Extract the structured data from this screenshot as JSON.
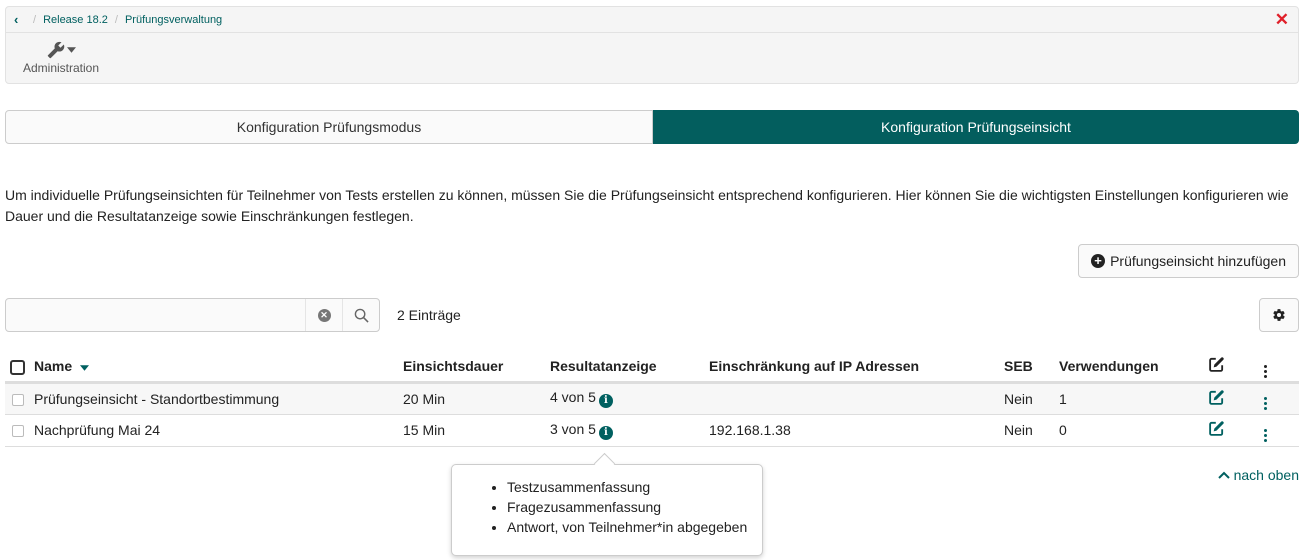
{
  "toolbar": {
    "breadcrumbs": [
      "Release 18.2",
      "Prüfungsverwaltung"
    ],
    "admin_label": "Administration"
  },
  "tabs": [
    {
      "label": "Konfiguration Prüfungsmodus",
      "active": false
    },
    {
      "label": "Konfiguration Prüfungseinsicht",
      "active": true
    }
  ],
  "description": "Um individuelle Prüfungseinsichten für Teilnehmer von Tests erstellen zu können, müssen Sie die Prüfungseinsicht entsprechend konfigurieren. Hier können Sie die wichtigsten Einstellungen konfigurieren wie Dauer und die Resultatanzeige sowie Einschränkungen festlegen.",
  "add_button": "Prüfungseinsicht hinzufügen",
  "search": {
    "value": "",
    "placeholder": ""
  },
  "entry_count": "2 Einträge",
  "table": {
    "headers": {
      "name": "Name",
      "duration": "Einsichtsdauer",
      "results": "Resultatanzeige",
      "ip": "Einschränkung auf IP Adressen",
      "seb": "SEB",
      "usage": "Verwendungen"
    },
    "rows": [
      {
        "name": "Prüfungseinsicht - Standortbestimmung",
        "duration": "20 Min",
        "results": "4 von 5",
        "ip": "",
        "seb": "Nein",
        "usage": "1"
      },
      {
        "name": "Nachprüfung Mai 24",
        "duration": "15 Min",
        "results": "3 von 5",
        "ip": "192.168.1.38",
        "seb": "Nein",
        "usage": "0"
      }
    ]
  },
  "popover": {
    "items": [
      "Testzusammenfassung",
      "Fragezusammenfassung",
      "Antwort, von Teilnehmer*in abgegeben"
    ]
  },
  "to_top": "nach oben",
  "colors": {
    "accent": "#035e5e",
    "close": "#e0202a"
  }
}
